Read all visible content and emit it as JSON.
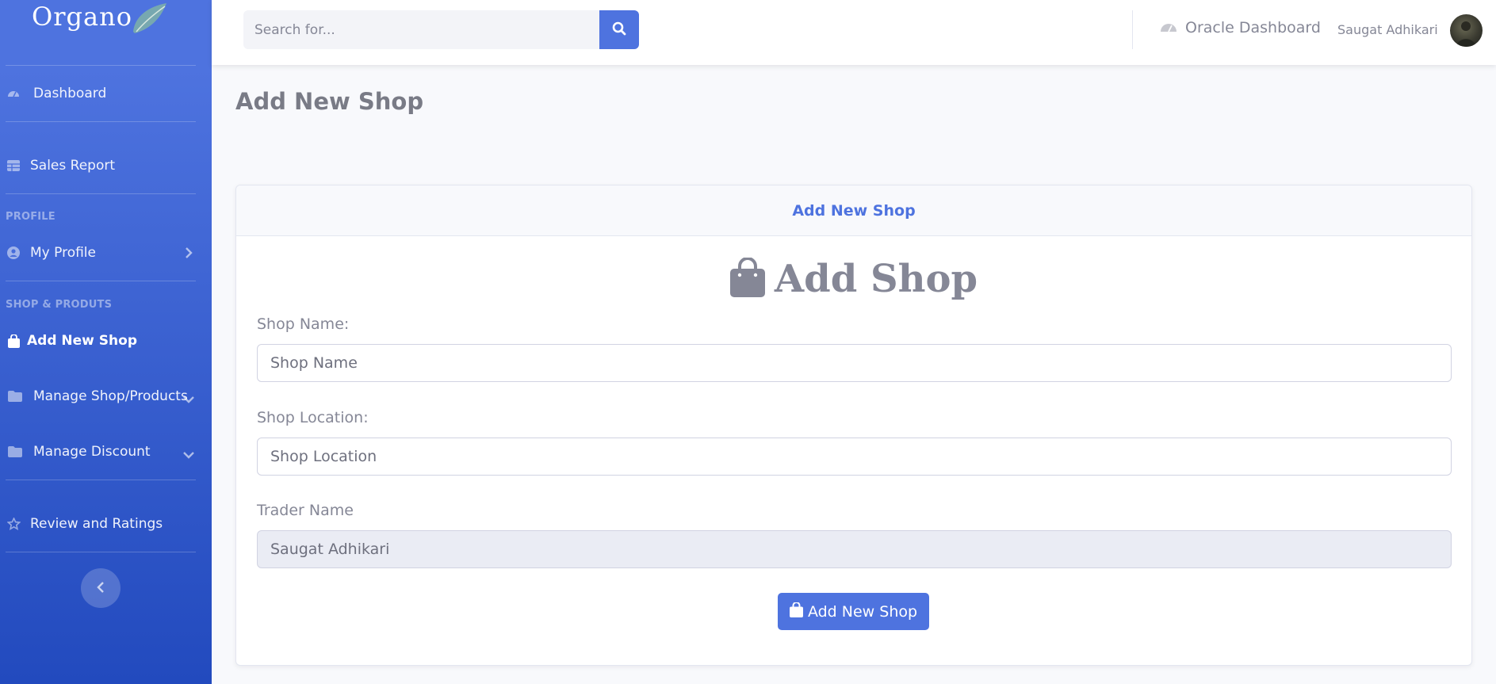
{
  "brand": {
    "name": "Organo"
  },
  "sidebar": {
    "items": [
      {
        "label": "Dashboard",
        "icon": "tachometer-icon"
      },
      {
        "label": "Sales Report",
        "icon": "table-icon"
      },
      {
        "label": "My Profile",
        "icon": "user-circle-icon"
      },
      {
        "label": "Add New Shop",
        "icon": "shopping-bag-icon"
      },
      {
        "label": "Manage Shop/Products",
        "icon": "folder-icon"
      },
      {
        "label": "Manage Discount",
        "icon": "folder-icon"
      },
      {
        "label": "Review and Ratings",
        "icon": "star-icon"
      }
    ],
    "headings": {
      "profile": "PROFILE",
      "shop": "SHOP & PRODUTS"
    }
  },
  "topbar": {
    "search_placeholder": "Search for...",
    "oracle_label": "Oracle Dashboard",
    "user_name": "Saugat Adhikari"
  },
  "page": {
    "title": "Add New Shop"
  },
  "card": {
    "header": "Add New Shop",
    "heading": "Add Shop",
    "fields": {
      "shop_name": {
        "label": "Shop Name:",
        "placeholder": "Shop Name"
      },
      "shop_location": {
        "label": "Shop Location:",
        "placeholder": "Shop Location"
      },
      "trader_name": {
        "label": "Trader Name",
        "value": "Saugat Adhikari"
      }
    },
    "submit_label": "Add New Shop"
  },
  "colors": {
    "primary": "#4e73df",
    "text": "#858796",
    "sidebar_dark": "#224abe"
  }
}
